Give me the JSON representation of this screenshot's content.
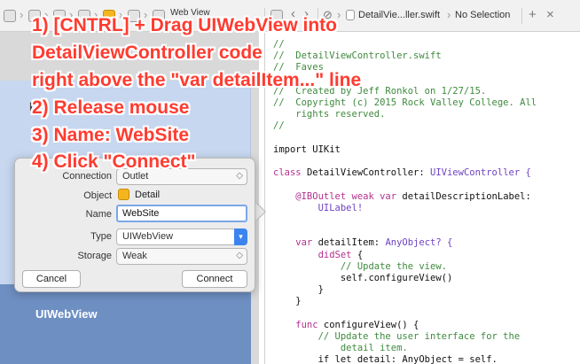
{
  "jumpbar": {
    "item_webview": "Web View",
    "item_file": "DetailVie...ller.swift",
    "item_selection": "No Selection",
    "add": "+",
    "close": "×"
  },
  "canvas": {
    "detail_peek": "D",
    "webview_label": "UIWebView"
  },
  "popover": {
    "connection_label": "Connection",
    "connection_value": "Outlet",
    "object_label": "Object",
    "object_value": "Detail",
    "name_label": "Name",
    "name_value": "WebSite",
    "type_label": "Type",
    "type_value": "UIWebView",
    "storage_label": "Storage",
    "storage_value": "Weak",
    "cancel_label": "Cancel",
    "connect_label": "Connect"
  },
  "code": {
    "l1": "//",
    "l2": "//  DetailViewController.swift",
    "l3": "//  Faves",
    "l4": "//",
    "l5": "//  Created by Jeff Ronkol on 1/27/15.",
    "l6": "//  Copyright (c) 2015 Rock Valley College. All",
    "l7": "    rights reserved.",
    "l8": "//",
    "l9": "import UIKit",
    "l10a": "class ",
    "l10b": "DetailViewController: ",
    "l10c": "UIViewController {",
    "l11a": "    @IBOutlet weak var ",
    "l11b": "detailDescriptionLabel:",
    "l12": "        UILabel!",
    "l13a": "    var ",
    "l13b": "detailItem: ",
    "l13c": "AnyObject? {",
    "l14a": "        didSet ",
    "l14b": "{",
    "l15": "            // Update the view.",
    "l16": "            self.configureView()",
    "l17": "        }",
    "l18": "    }",
    "l19a": "    func ",
    "l19b": "configureView() {",
    "l20": "        // Update the user interface for the",
    "l21": "            detail item.",
    "l22": "        if let detail: AnyObject = self."
  },
  "overlay": {
    "line1": "1) [CNTRL] + Drag UIWebView into",
    "line2": "DetailViewController code",
    "line3": "right above the \"var detailItem...\" line",
    "line4": "2) Release mouse",
    "line5": "3) Name: WebSite",
    "line6": "4) Click \"Connect\""
  },
  "colors": {
    "overlay_text": "#ff3b30",
    "comment": "#3e8a3e",
    "keyword": "#b3318f",
    "focus_ring": "#7aa7e8",
    "dropdown_accent": "#3b84f0"
  }
}
